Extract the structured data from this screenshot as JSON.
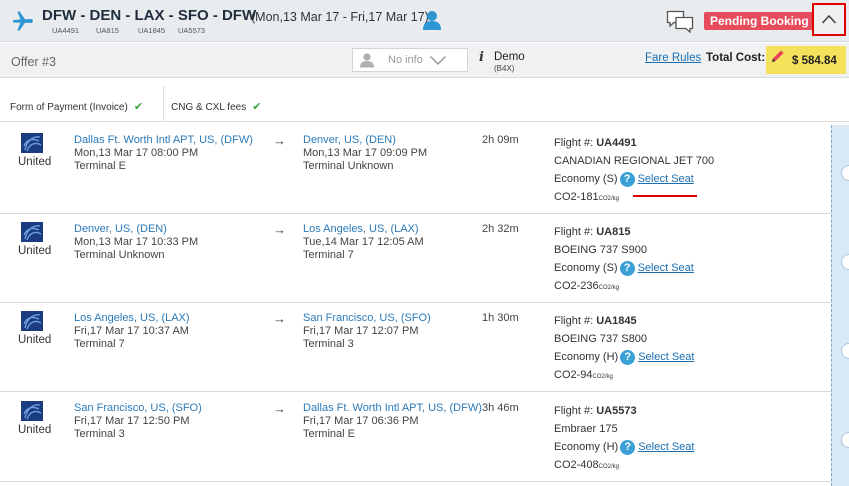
{
  "header": {
    "route": "DFW - DEN - LAX - SFO - DFW",
    "dates": "(Mon,13 Mar 17 - Fri,17 Mar 17)",
    "flight_codes": [
      "UA4491",
      "UA815",
      "UA1845",
      "UA5573"
    ],
    "status_badge": "Pending Booking"
  },
  "offer": {
    "label": "Offer #3",
    "traveler_select": "No info",
    "account": "Demo",
    "account_code": "(B4X)",
    "fare_rules_link": "Fare Rules",
    "total_cost_label": "Total Cost:",
    "total_cost_value": "$ 584.84"
  },
  "payment": {
    "form_of_payment": "Form of Payment (Invoice)",
    "cng_cxl": "CNG & CXL fees"
  },
  "segments": [
    {
      "airline": "United",
      "from_city": "Dallas Ft. Worth Intl APT, US, (DFW)",
      "from_datetime": "Mon,13 Mar 17 08:00 PM",
      "from_terminal": "Terminal E",
      "to_city": "Denver, US, (DEN)",
      "to_datetime": "Mon,13 Mar 17 09:09 PM",
      "to_terminal": "Terminal Unknown",
      "duration": "2h 09m",
      "flight_label": "Flight #:",
      "flight_number": "UA4491",
      "aircraft": "CANADIAN REGIONAL JET 700",
      "cabin": "Economy (S)",
      "select_seat": "Select Seat",
      "co2": "CO2-181",
      "co2_unit": "CO2/kg"
    },
    {
      "airline": "United",
      "from_city": "Denver, US, (DEN)",
      "from_datetime": "Mon,13 Mar 17 10:33 PM",
      "from_terminal": "Terminal Unknown",
      "to_city": "Los Angeles, US, (LAX)",
      "to_datetime": "Tue,14 Mar 17 12:05 AM",
      "to_terminal": "Terminal 7",
      "duration": "2h 32m",
      "flight_label": "Flight #:",
      "flight_number": "UA815",
      "aircraft": "BOEING 737 S900",
      "cabin": "Economy (S)",
      "select_seat": "Select Seat",
      "co2": "CO2-236",
      "co2_unit": "CO2/kg"
    },
    {
      "airline": "United",
      "from_city": "Los Angeles, US, (LAX)",
      "from_datetime": "Fri,17 Mar 17 10:37 AM",
      "from_terminal": "Terminal 7",
      "to_city": "San Francisco, US, (SFO)",
      "to_datetime": "Fri,17 Mar 17 12:07 PM",
      "to_terminal": "Terminal 3",
      "duration": "1h 30m",
      "flight_label": "Flight #:",
      "flight_number": "UA1845",
      "aircraft": "BOEING 737 S800",
      "cabin": "Economy (H)",
      "select_seat": "Select Seat",
      "co2": "CO2-94",
      "co2_unit": "CO2/kg"
    },
    {
      "airline": "United",
      "from_city": "San Francisco, US, (SFO)",
      "from_datetime": "Fri,17 Mar 17 12:50 PM",
      "from_terminal": "Terminal 3",
      "to_city": "Dallas Ft. Worth Intl APT, US, (DFW)",
      "to_datetime": "Fri,17 Mar 17 06:36 PM",
      "to_terminal": "Terminal E",
      "duration": "3h 46m",
      "flight_label": "Flight #:",
      "flight_number": "UA5573",
      "aircraft": "Embraer 175",
      "cabin": "Economy (H)",
      "select_seat": "Select Seat",
      "co2": "CO2-408",
      "co2_unit": "CO2/kg"
    }
  ],
  "colors": {
    "accent_blue": "#2c7ab8",
    "pending_red": "#e74c5c",
    "price_yellow": "#f6e15c",
    "check_green": "#3aa83a"
  }
}
